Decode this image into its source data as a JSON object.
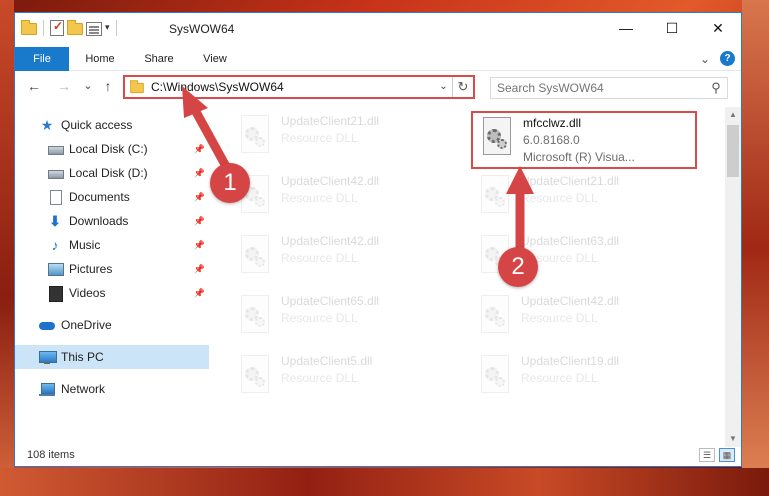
{
  "titlebar": {
    "title": "SysWOW64",
    "minimize": "—",
    "maximize": "☐",
    "close": "✕",
    "qat_dropdown": "▾"
  },
  "ribbon": {
    "tabs": [
      "File",
      "Home",
      "Share",
      "View"
    ],
    "expand": "⌄",
    "help": "?"
  },
  "nav": {
    "back": "←",
    "forward": "→",
    "recent": "⌄",
    "up": "↑",
    "address": "C:\\Windows\\SysWOW64",
    "address_dropdown": "⌄",
    "refresh": "↻",
    "search_placeholder": "Search SysWOW64",
    "search_icon": "magnifier-icon"
  },
  "sidebar": {
    "items": [
      {
        "label": "Quick access",
        "icon": "star-icon",
        "pinned": false
      },
      {
        "label": "Local Disk (C:)",
        "icon": "disk-icon",
        "pinned": true
      },
      {
        "label": "Local Disk (D:)",
        "icon": "disk-icon",
        "pinned": true
      },
      {
        "label": "Documents",
        "icon": "documents-icon",
        "pinned": true
      },
      {
        "label": "Downloads",
        "icon": "download-icon",
        "pinned": true
      },
      {
        "label": "Music",
        "icon": "music-icon",
        "pinned": true
      },
      {
        "label": "Pictures",
        "icon": "pictures-icon",
        "pinned": true
      },
      {
        "label": "Videos",
        "icon": "videos-icon",
        "pinned": true
      },
      {
        "label": "OneDrive",
        "icon": "onedrive-icon",
        "pinned": false
      },
      {
        "label": "This PC",
        "icon": "this-pc-icon",
        "pinned": false,
        "selected": true
      },
      {
        "label": "Network",
        "icon": "network-icon",
        "pinned": false
      }
    ],
    "pin_glyph": "📌"
  },
  "files": {
    "highlighted": {
      "name": "mfcclwz.dll",
      "version": "6.0.8168.0",
      "desc": "Microsoft (R) Visua..."
    },
    "left_column": [
      {
        "name": "UpdateClient21.dll",
        "type": "Resource DLL"
      },
      {
        "name": "UpdateClient42.dll",
        "type": "Resource DLL"
      },
      {
        "name": "UpdateClient42.dll",
        "type": "Resource DLL"
      },
      {
        "name": "UpdateClient65.dll",
        "type": "Resource DLL"
      },
      {
        "name": "UpdateClient5.dll",
        "type": "Resource DLL"
      }
    ],
    "right_column": [
      {
        "name": "UpdateClient21.dll",
        "type": "Resource DLL"
      },
      {
        "name": "UpdateClient63.dll",
        "type": "Resource DLL"
      },
      {
        "name": "UpdateClient42.dll",
        "type": "Resource DLL"
      },
      {
        "name": "UpdateClient19.dll",
        "type": "Resource DLL"
      }
    ]
  },
  "status": {
    "count": "108 items"
  },
  "annotations": {
    "callout_1": "1",
    "callout_2": "2",
    "color": "#d64545"
  }
}
